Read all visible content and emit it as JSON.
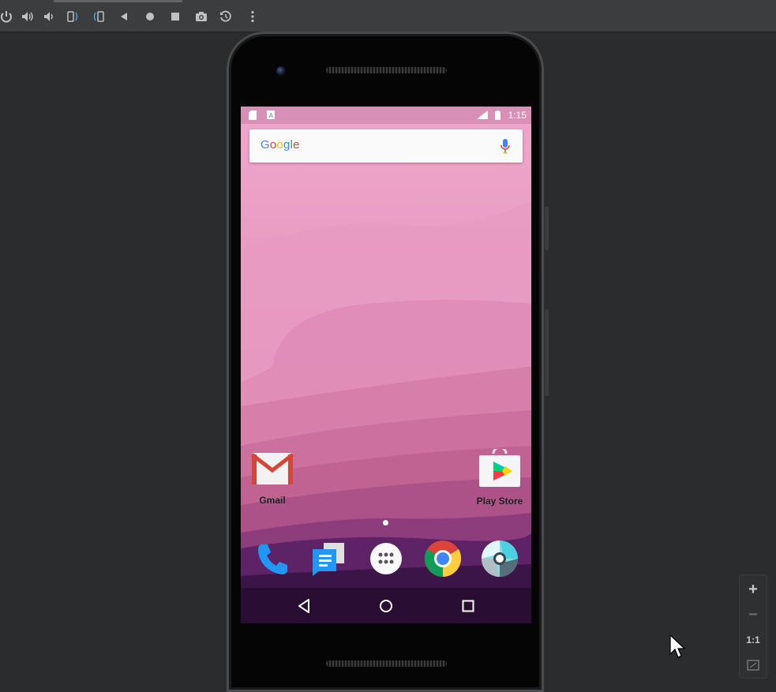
{
  "toolbar": {
    "buttons": [
      {
        "name": "power-icon"
      },
      {
        "name": "volume-up-icon"
      },
      {
        "name": "volume-down-icon"
      },
      {
        "name": "rotate-left-icon"
      },
      {
        "name": "rotate-right-icon"
      },
      {
        "name": "back-icon"
      },
      {
        "name": "home-icon"
      },
      {
        "name": "overview-icon"
      },
      {
        "name": "camera-icon"
      },
      {
        "name": "snapshot-icon"
      },
      {
        "name": "more-icon"
      }
    ],
    "accent": "#4a9fe5"
  },
  "device": {
    "status_bar": {
      "time": "1:15"
    },
    "search_bar": {
      "logo_text": "Google"
    },
    "home_apps": [
      {
        "label": "Gmail"
      },
      {
        "label": "Play Store"
      }
    ],
    "dock": [
      {
        "name": "phone-icon"
      },
      {
        "name": "messages-icon"
      },
      {
        "name": "app-drawer-icon"
      },
      {
        "name": "chrome-icon"
      },
      {
        "name": "camera-app-icon"
      }
    ],
    "nav": [
      "back",
      "home",
      "recents"
    ]
  },
  "zoom_panel": {
    "zoom_in": "+",
    "zoom_out": "−",
    "actual_size": "1:1"
  },
  "colors": {
    "wallpaper_top": "#efa6cb",
    "wallpaper_bottom": "#2a0d33",
    "toolbar_bg": "#3b3d3f",
    "workspace_bg": "#2b2c2e"
  }
}
